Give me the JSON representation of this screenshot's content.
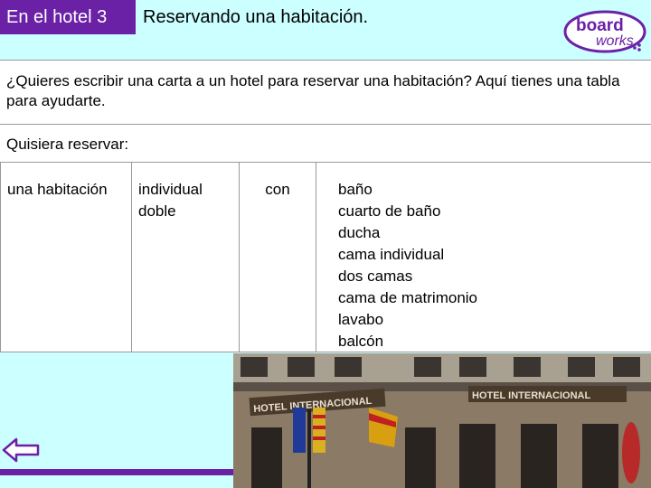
{
  "header": {
    "tag": "En el hotel 3",
    "title": "Reservando una habitación."
  },
  "logo": {
    "line1": "board",
    "line2": "works"
  },
  "intro": {
    "text": "¿Quieres escribir una carta a un hotel para reservar una habitación? Aquí tienes una tabla para ayudarte."
  },
  "table": {
    "heading": "Quisiera reservar:",
    "col1": [
      "una habitación"
    ],
    "col2": [
      "individual",
      "doble"
    ],
    "col3": [
      "con"
    ],
    "col4": [
      "baño",
      "cuarto de baño",
      "ducha",
      "cama individual",
      "dos camas",
      "cama de matrimonio",
      "lavabo",
      "balcón"
    ]
  },
  "photo": {
    "sign_left": "HOTEL INTERNACIONAL",
    "sign_right": "HOTEL INTERNACIONAL"
  },
  "nav": {
    "back_icon": "back-arrow-icon"
  },
  "colors": {
    "accent": "#6a21a6",
    "background": "#ccffff"
  }
}
